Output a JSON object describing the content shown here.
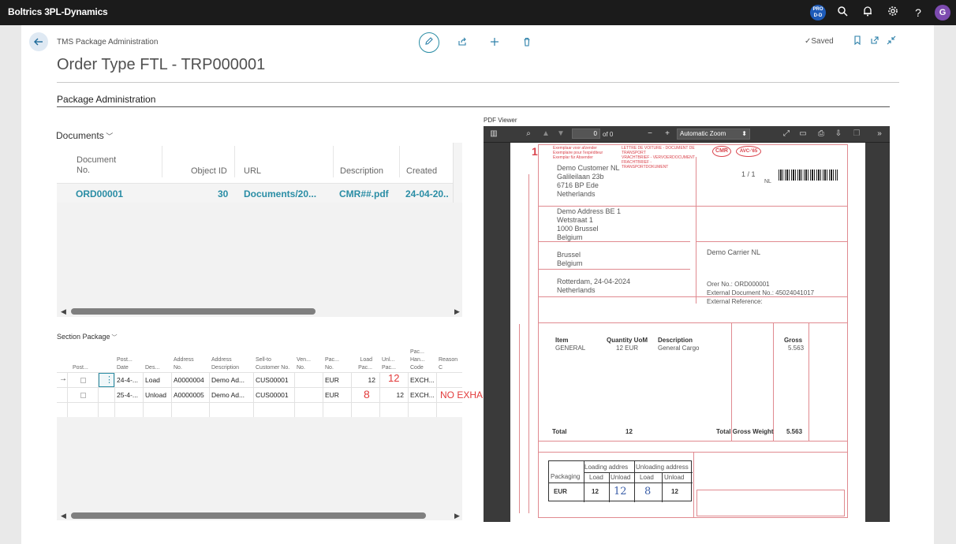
{
  "app": {
    "title": "Boltrics 3PL-Dynamics",
    "avatar_initial": "G",
    "pro_badge": "PRO D-D"
  },
  "header": {
    "breadcrumb": "TMS Package Administration",
    "title": "Order Type FTL - TRP000001",
    "saved_label": "Saved"
  },
  "section": {
    "title": "Package Administration"
  },
  "documents": {
    "caption": "Documents",
    "columns": [
      "Document No.",
      "Object ID",
      "URL",
      "Description",
      "Created"
    ],
    "rows": [
      {
        "doc_no": "ORD00001",
        "object_id": "30",
        "url": "Documents/20...",
        "description": "CMR##.pdf",
        "created": "24-04-20.."
      }
    ]
  },
  "package": {
    "caption": "Section Package",
    "columns": [
      "Post...",
      "Post... Date",
      "Des...",
      "Address No.",
      "Address Description",
      "Sell-to Customer No.",
      "Ven... No.",
      "Pac... No.",
      "Load Pac...",
      "Unl... Pac...",
      "Pac... Han... Code",
      "Reason C"
    ],
    "rows": [
      {
        "date": "24-4-...",
        "desc": "Load",
        "addr_no": "A0000004",
        "addr_desc": "Demo Ad...",
        "customer": "CUS00001",
        "pac_no": "EUR",
        "load": "12",
        "unload": "",
        "code": "EXCH..."
      },
      {
        "date": "25-4-...",
        "desc": "Unload",
        "addr_no": "A0000005",
        "addr_desc": "Demo Ad...",
        "customer": "CUS00001",
        "pac_no": "EUR",
        "load": "",
        "unload": "12",
        "code": "EXCH..."
      }
    ],
    "annotations": {
      "unload_row1": "12",
      "load_row2": "8",
      "note": "NO EXHANGE"
    }
  },
  "pdf": {
    "label": "PDF Viewer",
    "page_value": "0",
    "page_of": "of 0",
    "zoom": "Automatic Zoom",
    "cmr": {
      "copy_no": "1",
      "sender": [
        "Demo Customer NL",
        "Galileilaan 23b",
        "6716 BP  Ede",
        "Netherlands"
      ],
      "consignee": [
        "Demo Address BE 1",
        "Wetstraat 1",
        "1000  Brussel",
        "Belgium"
      ],
      "delivery_place": [
        "Brussel",
        "Belgium"
      ],
      "loading_place": [
        "Rotterdam, 24-04-2024",
        "Netherlands"
      ],
      "carrier": "Demo Carrier NL",
      "refs": [
        "Orer No.: ORD000001",
        "External Document No.: 45024041017",
        "External Reference:"
      ],
      "page_count": "1 / 1",
      "country": "NL",
      "goods_headers": [
        "Item",
        "Quantity UoM",
        "Description",
        "Gross"
      ],
      "goods_row": [
        "GENERAL",
        "12 EUR",
        "General Cargo",
        "5.563"
      ],
      "total_label": "Total",
      "total_qty": "12",
      "total_weight_label": "Total Gross Weight",
      "total_weight": "5.563",
      "pack_table": {
        "header_loading": "Loading addres",
        "header_unloading": "Unloading address",
        "sub": [
          "Packaging",
          "Load",
          "Unload",
          "Load",
          "Unload"
        ],
        "row": [
          "EUR",
          "12",
          "12",
          "8",
          "12"
        ]
      }
    }
  }
}
